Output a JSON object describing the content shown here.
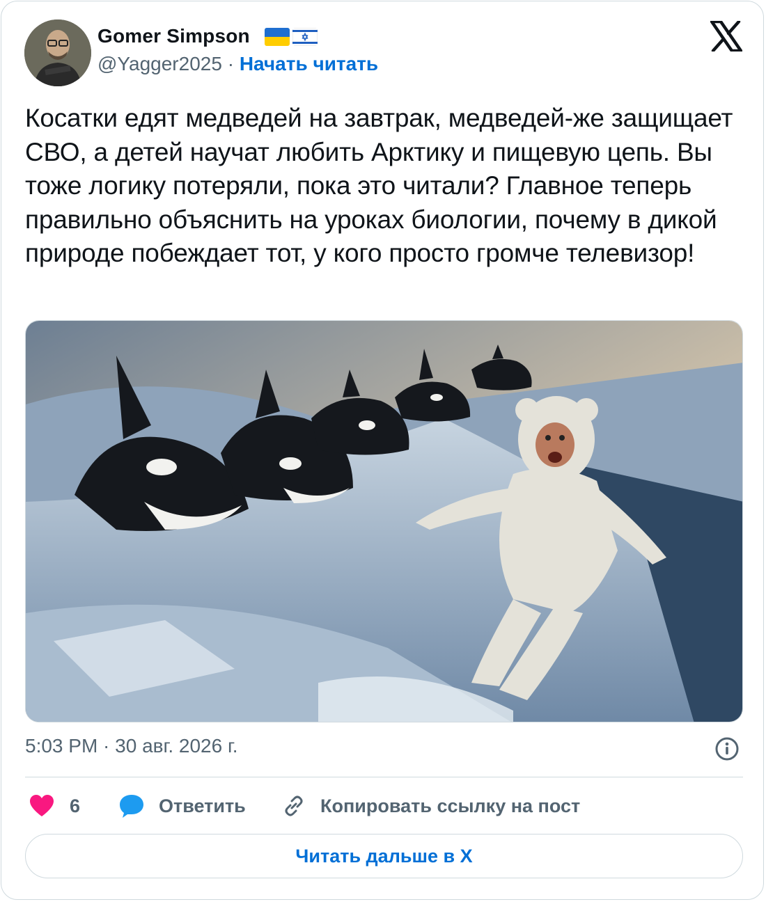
{
  "author": {
    "name": "Gomer Simpson",
    "handle": "@Yagger2025",
    "separator": "·",
    "follow_label": "Начать читать",
    "flags": [
      "ukraine-flag-icon",
      "israel-flag-icon"
    ]
  },
  "brand": {
    "logo": "x-logo-icon"
  },
  "tweet": {
    "text": "Косатки едят медведей на завтрак, медведей-же защищает СВО, а детей научат любить Арктику и пищевую цепь. Вы тоже логику потеряли, пока это читали? Главное теперь правильно объяснить на уроках биологии, почему в дикой природе побеждает тот, у кого просто громче телевизор!",
    "media": {
      "type": "image",
      "icon": "photo"
    },
    "timestamp": "5:03 PM · 30 авг. 2026 г."
  },
  "actions": {
    "like_count": "6",
    "reply_label": "Ответить",
    "copy_label": "Копировать ссылку на пост"
  },
  "read_more_label": "Читать дальше в X",
  "colors": {
    "link": "#006fd6",
    "like": "#f91880",
    "reply": "#1d9bf0",
    "secondary_text": "#536471",
    "border": "#cfd9de"
  }
}
